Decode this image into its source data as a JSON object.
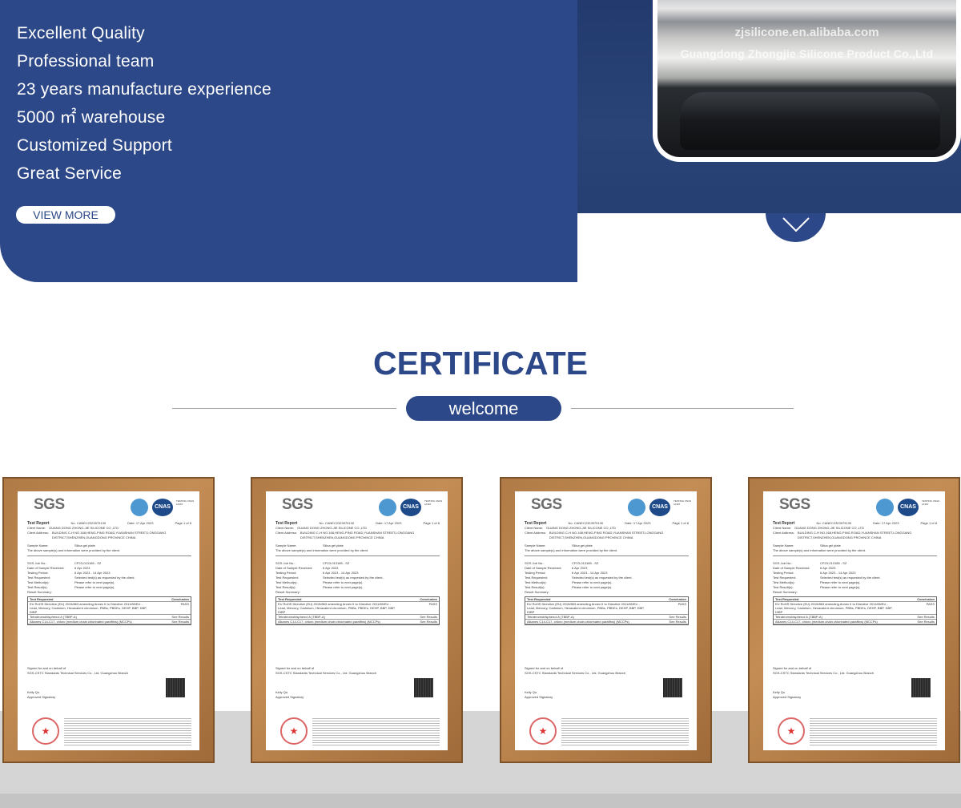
{
  "hero": {
    "features": [
      "Excellent Quality",
      "Professional team",
      "23 years manufacture experience",
      "5000 ㎡ warehouse",
      "Customized Support",
      "Great Service"
    ],
    "view_more_label": "VIEW MORE",
    "photo_watermark_1": "zjsilicone.en.alibaba.com",
    "photo_watermark_2": "Guangdong Zhongjie Silicone Product Co.,Ltd",
    "scroll_icon": "chevron-down-icon"
  },
  "section": {
    "title": "CERTIFICATE",
    "subtitle": "welcome"
  },
  "certificate": {
    "logo": "SGS",
    "cnas": "CNAS",
    "accreditation": "TESTING CNAS L0167",
    "report_title": "Test Report",
    "report_no": "No. CANEC2323979130",
    "date": "Date: 17 Apr 2023",
    "page": "Page 1 of 8",
    "client_name_label": "Client Name:",
    "client_name": "GUANG DONG ZHONG-JIE SILICONE CO.,LTD",
    "client_address_label": "Client Address:",
    "client_address": "BUILDING C-H NO.168,HENG-PING ROAD,YUANSHAN STREET,LONGGANG DISTRICT,SHENZHEN,GUANGDONG PROVINCE CHINA",
    "sample_name_label": "Sample Name:",
    "sample_name": "Silica gel plate",
    "sample_note": "The above sample(s) and information were provided by the client.",
    "fields": [
      {
        "label": "SGS Job No.:",
        "value": "CP23-013185 - SZ"
      },
      {
        "label": "Date of Sample Received:",
        "value": "6 Apr 2023"
      },
      {
        "label": "Testing Period:",
        "value": "6 Apr 2023 - 14 Apr 2023"
      },
      {
        "label": "Test Requested:",
        "value": "Selected test(s) as requested by the client."
      },
      {
        "label": "Test Method(s):",
        "value": "Please refer to next page(s)."
      },
      {
        "label": "Test Result(s):",
        "value": "Please refer to next page(s)."
      }
    ],
    "summary_label": "Result Summary:",
    "table_headers": [
      "Test Requested",
      "Conclusion"
    ],
    "table_rows": [
      {
        "test": "EU RoHS Directive (EU) 2015/863 amending Annex II to Directive 2011/65/EU - Lead, Mercury, Cadmium, Hexavalent chromium, PBBs, PBDEs, DEHP, BBP, DBP, DIBP",
        "result": "PASS"
      },
      {
        "test": "Tetrabromobisphenol A (TBBP-A)",
        "result": "See Results"
      },
      {
        "test": "Alkanes C14-C17, chloro (medium chain chlorinated paraffins) (MCCPs)",
        "result": "See Results"
      }
    ],
    "signed_for": "Signed for and on behalf of",
    "signed_company": "SGS-CSTC Standards Technical Services Co., Ltd. Guangzhou Branch",
    "signatory_name": "Kelly Qu",
    "signatory_title": "Approved Signatory"
  }
}
